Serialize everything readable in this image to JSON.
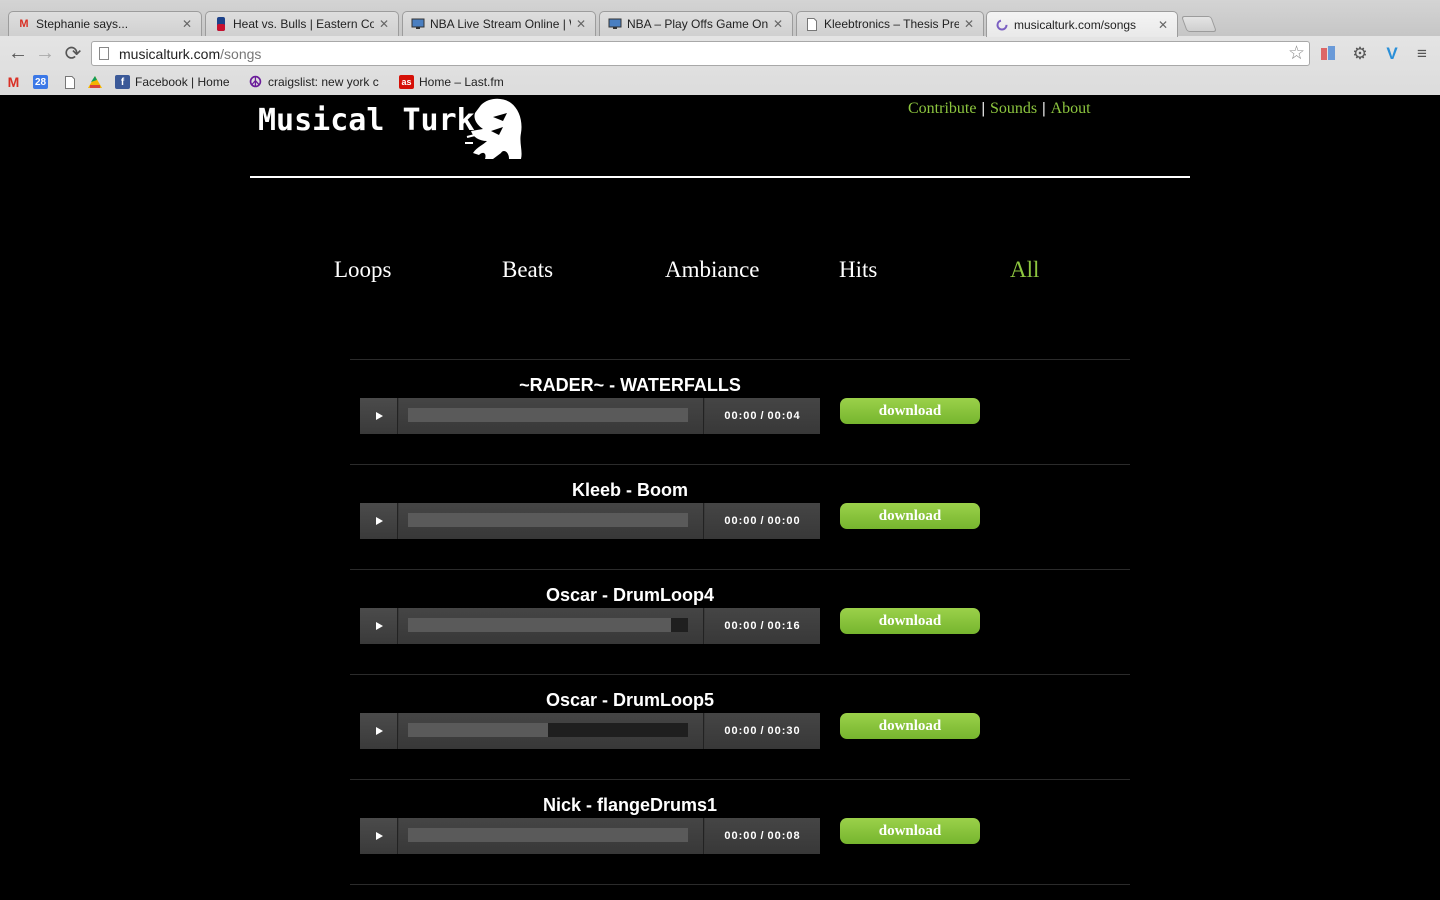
{
  "browser": {
    "tabs": [
      {
        "title": "Stephanie says...",
        "icon": "gmail-icon",
        "active": false
      },
      {
        "title": "Heat vs. Bulls | Eastern Co",
        "icon": "nba-icon",
        "active": false
      },
      {
        "title": "NBA Live Stream Online | W",
        "icon": "monitor-icon",
        "active": false
      },
      {
        "title": "NBA – Play Offs Game One",
        "icon": "monitor-icon",
        "active": false
      },
      {
        "title": "Kleebtronics – Thesis Pres",
        "icon": "document-icon",
        "active": false
      },
      {
        "title": "musicalturk.com/songs",
        "icon": "loading-icon",
        "active": true
      }
    ],
    "url_domain": "musicalturk.com",
    "url_path": "/songs",
    "bookmarks": [
      {
        "label": "",
        "icon": "gmail-icon"
      },
      {
        "label": "",
        "icon": "calendar-icon",
        "text": "28"
      },
      {
        "label": "",
        "icon": "document-icon"
      },
      {
        "label": "",
        "icon": "drive-icon"
      },
      {
        "label": "Facebook | Home",
        "icon": "facebook-icon"
      },
      {
        "label": "craigslist: new york c",
        "icon": "peace-icon"
      },
      {
        "label": "Home – Last.fm",
        "icon": "lastfm-icon"
      }
    ],
    "colors": {
      "gmail": "#d93025",
      "calendar": "#3b78e7",
      "facebook": "#3b5998",
      "craigslist": "#6a1b9a",
      "lastfm": "#d51007"
    }
  },
  "site": {
    "logo_text": "Musical Turk",
    "nav": [
      "Contribute",
      "Sounds",
      "About"
    ],
    "categories": [
      {
        "label": "Loops",
        "active": false
      },
      {
        "label": "Beats",
        "active": false
      },
      {
        "label": "Ambiance",
        "active": false
      },
      {
        "label": "Hits",
        "active": false
      },
      {
        "label": "All",
        "active": true
      }
    ],
    "accent_color": "#8dc63f",
    "download_label": "download",
    "songs": [
      {
        "title": "~RADER~ - WATERFALLS",
        "current": "00:00",
        "duration": "00:04",
        "buffered": 1.0
      },
      {
        "title": "Kleeb - Boom",
        "current": "00:00",
        "duration": "00:00",
        "buffered": 1.0
      },
      {
        "title": "Oscar - DrumLoop4",
        "current": "00:00",
        "duration": "00:16",
        "buffered": 0.94
      },
      {
        "title": "Oscar - DrumLoop5",
        "current": "00:00",
        "duration": "00:30",
        "buffered": 0.5
      },
      {
        "title": "Nick - flangeDrums1",
        "current": "00:00",
        "duration": "00:08",
        "buffered": 1.0
      }
    ]
  }
}
